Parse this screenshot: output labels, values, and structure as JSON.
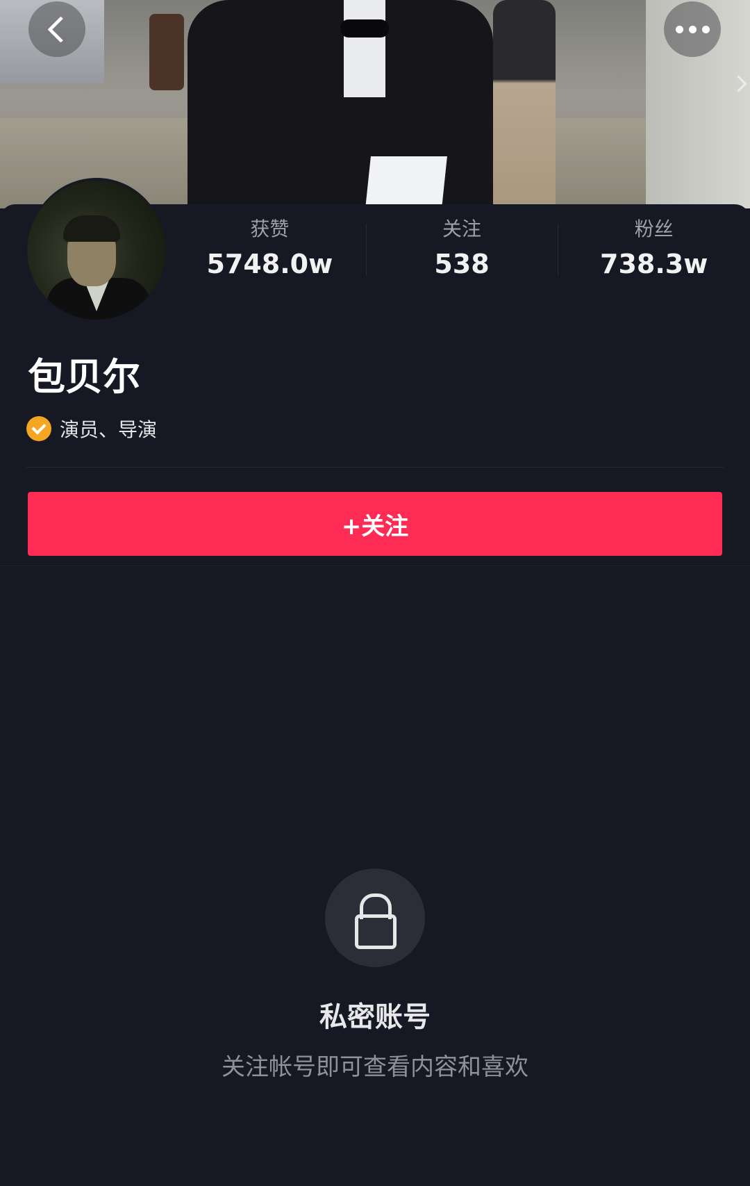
{
  "header": {
    "back_icon": "chevron-left-icon",
    "more_icon": "more-dots-icon"
  },
  "profile": {
    "name": "包贝尔",
    "verification": "演员、导演",
    "verification_icon": "check-badge-icon",
    "verification_color": "#f5a623"
  },
  "stats": [
    {
      "label": "获赞",
      "value": "5748.0w"
    },
    {
      "label": "关注",
      "value": "538"
    },
    {
      "label": "粉丝",
      "value": "738.3w"
    }
  ],
  "follow_button": {
    "label": "+关注",
    "color": "#fe2c55"
  },
  "private": {
    "icon": "lock-icon",
    "title": "私密账号",
    "subtitle": "关注帐号即可查看内容和喜欢"
  },
  "colors": {
    "background": "#161823",
    "accent": "#fe2c55"
  }
}
